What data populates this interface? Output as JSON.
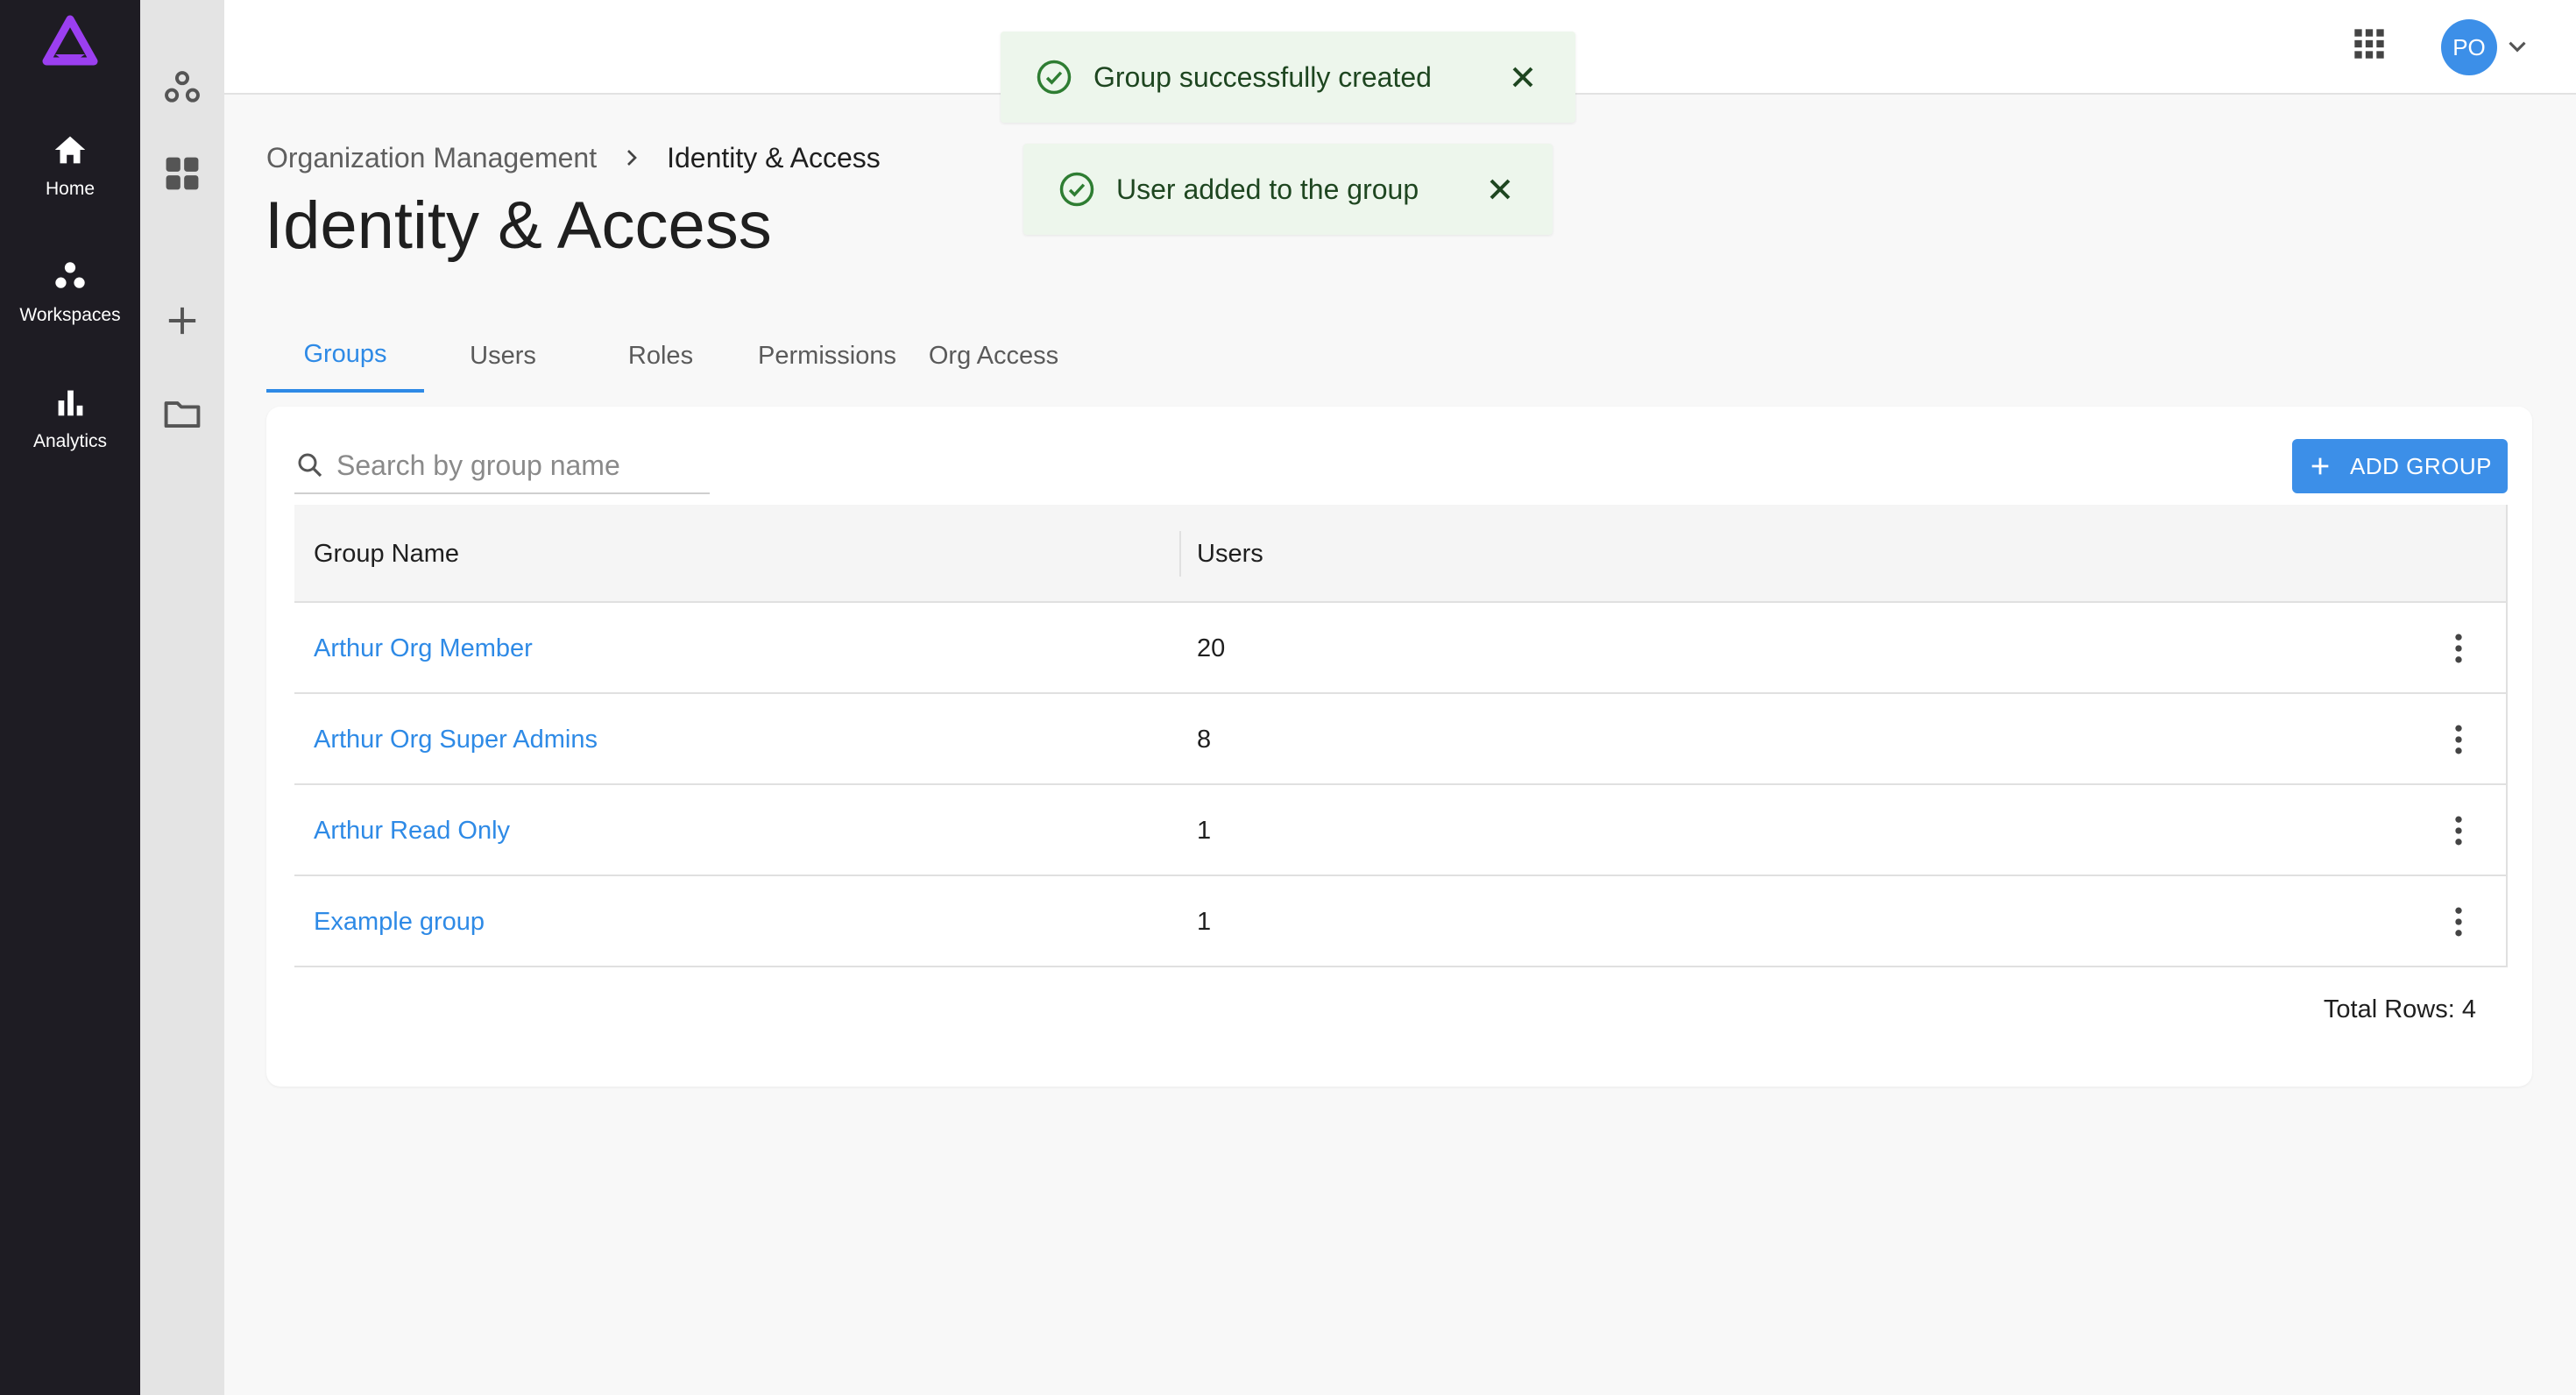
{
  "nav": {
    "items": [
      {
        "label": "Home",
        "icon": "home-icon"
      },
      {
        "label": "Workspaces",
        "icon": "workspaces-icon"
      },
      {
        "label": "Analytics",
        "icon": "analytics-icon"
      }
    ]
  },
  "header": {
    "avatar_initials": "PO"
  },
  "toasts": [
    {
      "message": "Group successfully created"
    },
    {
      "message": "User added to the group"
    }
  ],
  "breadcrumb": {
    "parent": "Organization Management",
    "current": "Identity & Access"
  },
  "page": {
    "title": "Identity & Access"
  },
  "tabs": [
    {
      "label": "Groups",
      "active": true
    },
    {
      "label": "Users",
      "active": false
    },
    {
      "label": "Roles",
      "active": false
    },
    {
      "label": "Permissions",
      "active": false
    },
    {
      "label": "Org Access",
      "active": false
    }
  ],
  "search": {
    "placeholder": "Search by group name",
    "value": ""
  },
  "toolbar": {
    "add_label": "ADD GROUP"
  },
  "table": {
    "headers": [
      "Group Name",
      "Users"
    ],
    "rows": [
      {
        "name": "Arthur Org Member",
        "users": "20"
      },
      {
        "name": "Arthur Org Super Admins",
        "users": "8"
      },
      {
        "name": "Arthur Read Only",
        "users": "1"
      },
      {
        "name": "Example group",
        "users": "1"
      }
    ],
    "total_label": "Total Rows: 4"
  },
  "colors": {
    "accent": "#3c8fe8",
    "nav_dark": "#1e1c23",
    "brand": "#9b3ff0",
    "success": "#2e7d32",
    "toast_bg": "#edf6ec"
  }
}
